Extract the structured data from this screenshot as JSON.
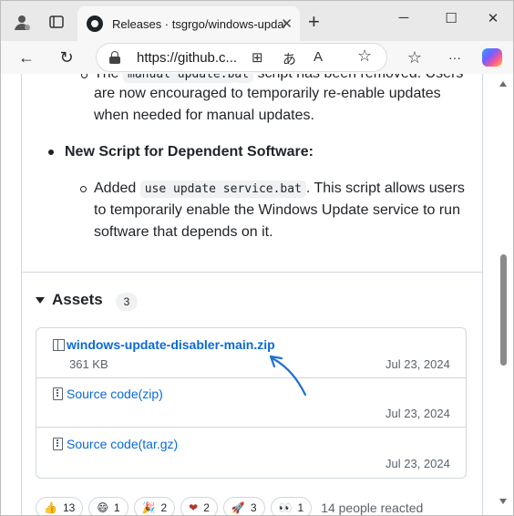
{
  "browser": {
    "tab_title": "Releases · tsgrgo/windows-update",
    "url": "https://github.c...",
    "icons": [
      "profile-icon",
      "tab-actions-icon",
      "github-icon",
      "close-icon",
      "new-tab-icon",
      "minimize-icon",
      "maximize-icon",
      "close-window-icon",
      "back-icon",
      "refresh-icon",
      "lock-icon",
      "split-screen-icon",
      "read-aloud-icon",
      "text-size-icon",
      "favorite-icon",
      "favorites-icon",
      "more-icon",
      "copilot-icon"
    ],
    "glyphs": {
      "newtab": "+",
      "close": "✕",
      "minimize": "─",
      "maximize": "☐",
      "back": "←",
      "refresh": "↻",
      "split": "⊞",
      "translate": "あ",
      "readaloud": "A",
      "favorite": "☆",
      "favorites": "☆",
      "more": "···",
      "tabs": "▣",
      "profile": "●"
    }
  },
  "release": {
    "partial_prefix": "The ",
    "partial_code": "manual update.bat",
    "partial_suffix": " script has been removed. Users",
    "line2": "are now encouraged to temporarily re-enable updates",
    "line3": "when needed for manual updates.",
    "new_script_heading": "New Script for Dependent Software:",
    "added_prefix": "Added ",
    "added_code": "use update service.bat",
    "added_suffix": ". This script allows users",
    "added_line2": "to temporarily enable the Windows Update service to run",
    "added_line3": "software that depends on it."
  },
  "assets": {
    "title": "Assets",
    "count": "3",
    "items": [
      {
        "name": "windows-update-disabler-main.zip",
        "size": "361 KB",
        "date": "Jul 23, 2024"
      },
      {
        "name": "Source code",
        "suffix": " (zip)",
        "date": "Jul 23, 2024"
      },
      {
        "name": "Source code",
        "suffix": " (tar.gz)",
        "date": "Jul 23, 2024"
      }
    ]
  },
  "reactions": {
    "items": [
      {
        "emoji": "👍",
        "count": "13"
      },
      {
        "emoji": "😄",
        "count": "1"
      },
      {
        "emoji": "🎉",
        "count": "2"
      },
      {
        "emoji": "❤",
        "count": "2"
      },
      {
        "emoji": "🚀",
        "count": "3"
      },
      {
        "emoji": "👀",
        "count": "1"
      }
    ],
    "summary": "14 people reacted"
  },
  "colors": {
    "link": "#0969da",
    "annotation_arrow": "#1f6fd1",
    "text": "#1f2328",
    "muted": "#59636e"
  }
}
